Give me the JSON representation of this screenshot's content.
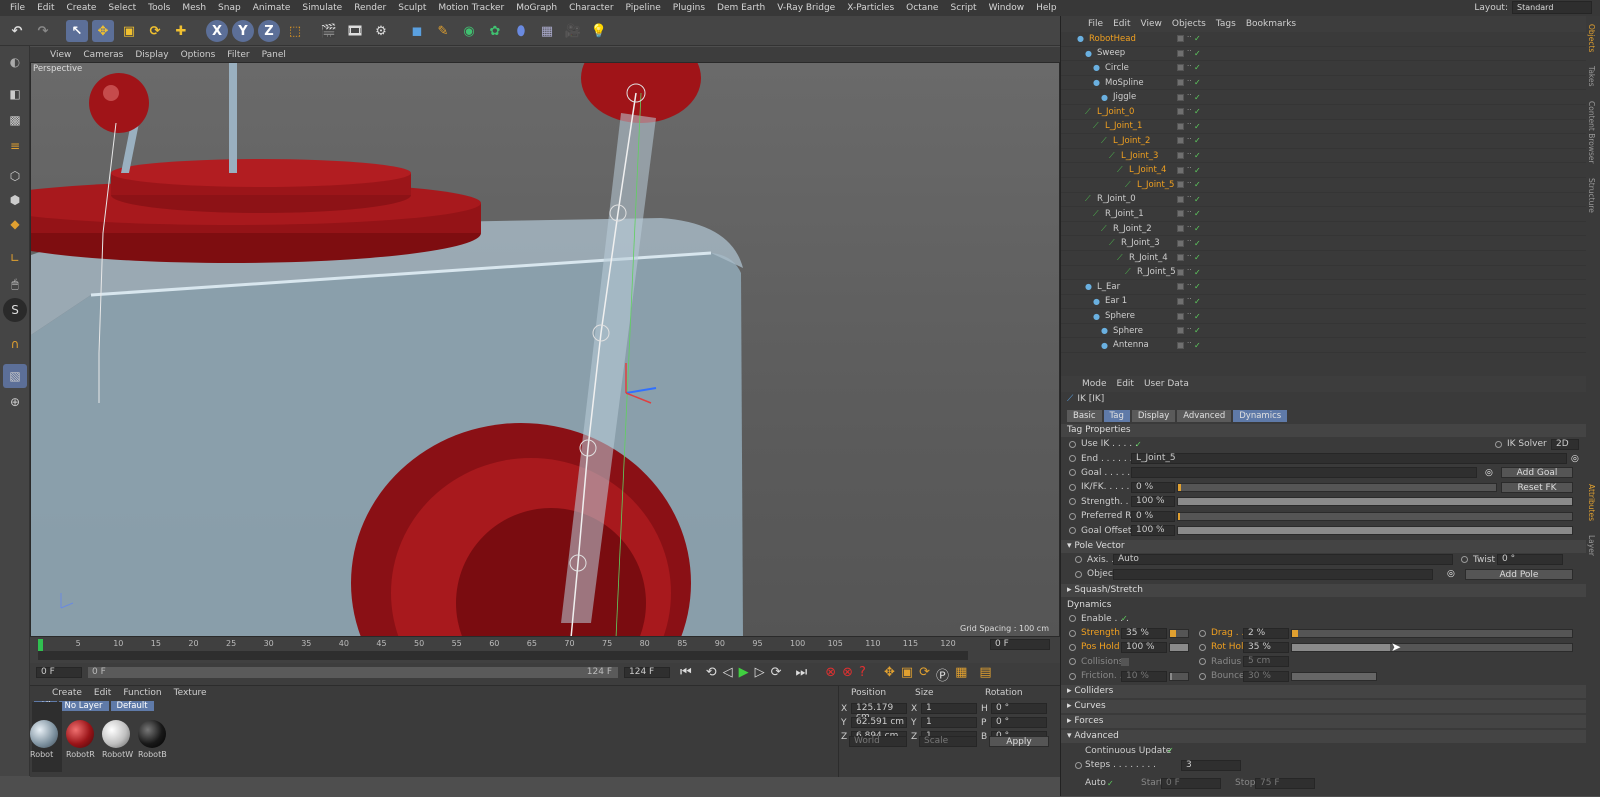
{
  "menu": [
    "File",
    "Edit",
    "Create",
    "Select",
    "Tools",
    "Mesh",
    "Snap",
    "Animate",
    "Simulate",
    "Render",
    "Sculpt",
    "Motion Tracker",
    "MoGraph",
    "Character",
    "Pipeline",
    "Plugins",
    "Dem Earth",
    "V-Ray Bridge",
    "X-Particles",
    "Octane",
    "Script",
    "Window",
    "Help"
  ],
  "layout": {
    "label": "Layout:",
    "value": "Standard"
  },
  "toolbar": {
    "x": "X",
    "y": "Y",
    "z": "Z"
  },
  "viewport": {
    "menu": [
      "View",
      "Cameras",
      "Display",
      "Options",
      "Filter",
      "Panel"
    ],
    "label": "Perspective",
    "grid": "Grid Spacing : 100 cm"
  },
  "timeline": {
    "ticks": [
      "0",
      "5",
      "10",
      "15",
      "20",
      "25",
      "30",
      "35",
      "40",
      "45",
      "50",
      "55",
      "60",
      "65",
      "70",
      "75",
      "80",
      "85",
      "90",
      "95",
      "100",
      "105",
      "110",
      "115",
      "120"
    ],
    "frame": "0 F"
  },
  "transport": {
    "start": "0 F",
    "startin": "0 F",
    "endin": "124 F",
    "end": "124 F"
  },
  "materials": {
    "menu": [
      "Create",
      "Edit",
      "Function",
      "Texture"
    ],
    "filters": [
      "All",
      "No Layer",
      "Default"
    ],
    "items": [
      "Robot",
      "RobotR",
      "RobotW",
      "RobotB"
    ]
  },
  "coords": {
    "headers": [
      "Position",
      "Size",
      "Rotation"
    ],
    "rows": [
      {
        "a": "X",
        "p": "125.179 cm",
        "sa": "X",
        "s": "1",
        "ra": "H",
        "r": "0 °"
      },
      {
        "a": "Y",
        "p": "62.591 cm",
        "sa": "Y",
        "s": "1",
        "ra": "P",
        "r": "0 °"
      },
      {
        "a": "Z",
        "p": "6.894 cm",
        "sa": "Z",
        "s": "1",
        "ra": "B",
        "r": "0 °"
      }
    ],
    "mode1": "World",
    "mode2": "Scale",
    "apply": "Apply"
  },
  "objects": {
    "menu": [
      "File",
      "Edit",
      "View",
      "Objects",
      "Tags",
      "Bookmarks"
    ],
    "items": [
      {
        "name": "RobotHead",
        "indent": 0,
        "orange": true
      },
      {
        "name": "Sweep",
        "indent": 1,
        "orange": false
      },
      {
        "name": "Circle",
        "indent": 2,
        "orange": false
      },
      {
        "name": "MoSpline",
        "indent": 2,
        "orange": false
      },
      {
        "name": "Jiggle",
        "indent": 3,
        "orange": false
      },
      {
        "name": "L_Joint_0",
        "indent": 1,
        "orange": true
      },
      {
        "name": "L_Joint_1",
        "indent": 2,
        "orange": true
      },
      {
        "name": "L_Joint_2",
        "indent": 3,
        "orange": true
      },
      {
        "name": "L_Joint_3",
        "indent": 4,
        "orange": true
      },
      {
        "name": "L_Joint_4",
        "indent": 5,
        "orange": true
      },
      {
        "name": "L_Joint_5",
        "indent": 6,
        "orange": true
      },
      {
        "name": "R_Joint_0",
        "indent": 1,
        "orange": false
      },
      {
        "name": "R_Joint_1",
        "indent": 2,
        "orange": false
      },
      {
        "name": "R_Joint_2",
        "indent": 3,
        "orange": false
      },
      {
        "name": "R_Joint_3",
        "indent": 4,
        "orange": false
      },
      {
        "name": "R_Joint_4",
        "indent": 5,
        "orange": false
      },
      {
        "name": "R_Joint_5",
        "indent": 6,
        "orange": false
      },
      {
        "name": "L_Ear",
        "indent": 1,
        "orange": false
      },
      {
        "name": "Ear 1",
        "indent": 2,
        "orange": false
      },
      {
        "name": "Sphere",
        "indent": 2,
        "orange": false
      },
      {
        "name": "Sphere",
        "indent": 3,
        "orange": false
      },
      {
        "name": "Antenna",
        "indent": 3,
        "orange": false
      }
    ]
  },
  "attr": {
    "menu": [
      "Mode",
      "Edit",
      "User Data"
    ],
    "title": "IK [IK]",
    "tabs": [
      "Basic",
      "Tag",
      "Display",
      "Advanced",
      "Dynamics"
    ],
    "tagprops": "Tag Properties",
    "useik": "Use IK . . . . .",
    "iksolver": "IK Solver",
    "iksolverval": "2D",
    "end": "End . . . . . .",
    "endval": "L_Joint_5",
    "goal": "Goal . . . . . .",
    "addgoal": "Add Goal",
    "ikfk": "IK/FK. . . . . .",
    "ikfkval": "0 %",
    "resetfk": "Reset FK",
    "strength": "Strength. . . . .",
    "strengthval": "100 %",
    "prefrot": "Preferred Rot",
    "prefrotval": "0 %",
    "goaloffset": "Goal Offset",
    "goaloffsetval": "100 %",
    "polevector": "Pole Vector",
    "axis": "Axis. . . . . . .",
    "axisval": "Auto",
    "twist": "Twist",
    "twistval": "0 °",
    "object": "Object",
    "addpole": "Add Pole",
    "squash": "Squash/Stretch",
    "dynamics": "Dynamics",
    "enable": "Enable . . .",
    "dstrength": "Strength",
    "dstrengthval": "35 %",
    "drag": "Drag . . .",
    "dragval": "2 %",
    "poshold": "Pos Hold",
    "posholdval": "100 %",
    "rothold": "Rot Hold",
    "rotholdval": "35 %",
    "collisions": "Collisions",
    "radius": "Radius . .",
    "radiusval": "5 cm",
    "friction": "Friction. . .",
    "frictionval": "10 %",
    "bounce": "Bounce",
    "bounceval": "30 %",
    "colliders": "Colliders",
    "curves": "Curves",
    "forces": "Forces",
    "advanced": "Advanced",
    "contupdate": "Continuous Update",
    "steps": "Steps . . . . . . . .",
    "stepsval": "3",
    "auto": "Auto",
    "start": "Start",
    "startval": "0 F",
    "stop": "Stop",
    "stopval": "75 F"
  },
  "sidetabs": [
    "Objects",
    "Takes",
    "Content Browser",
    "Structure",
    "Attributes",
    "Layer"
  ]
}
